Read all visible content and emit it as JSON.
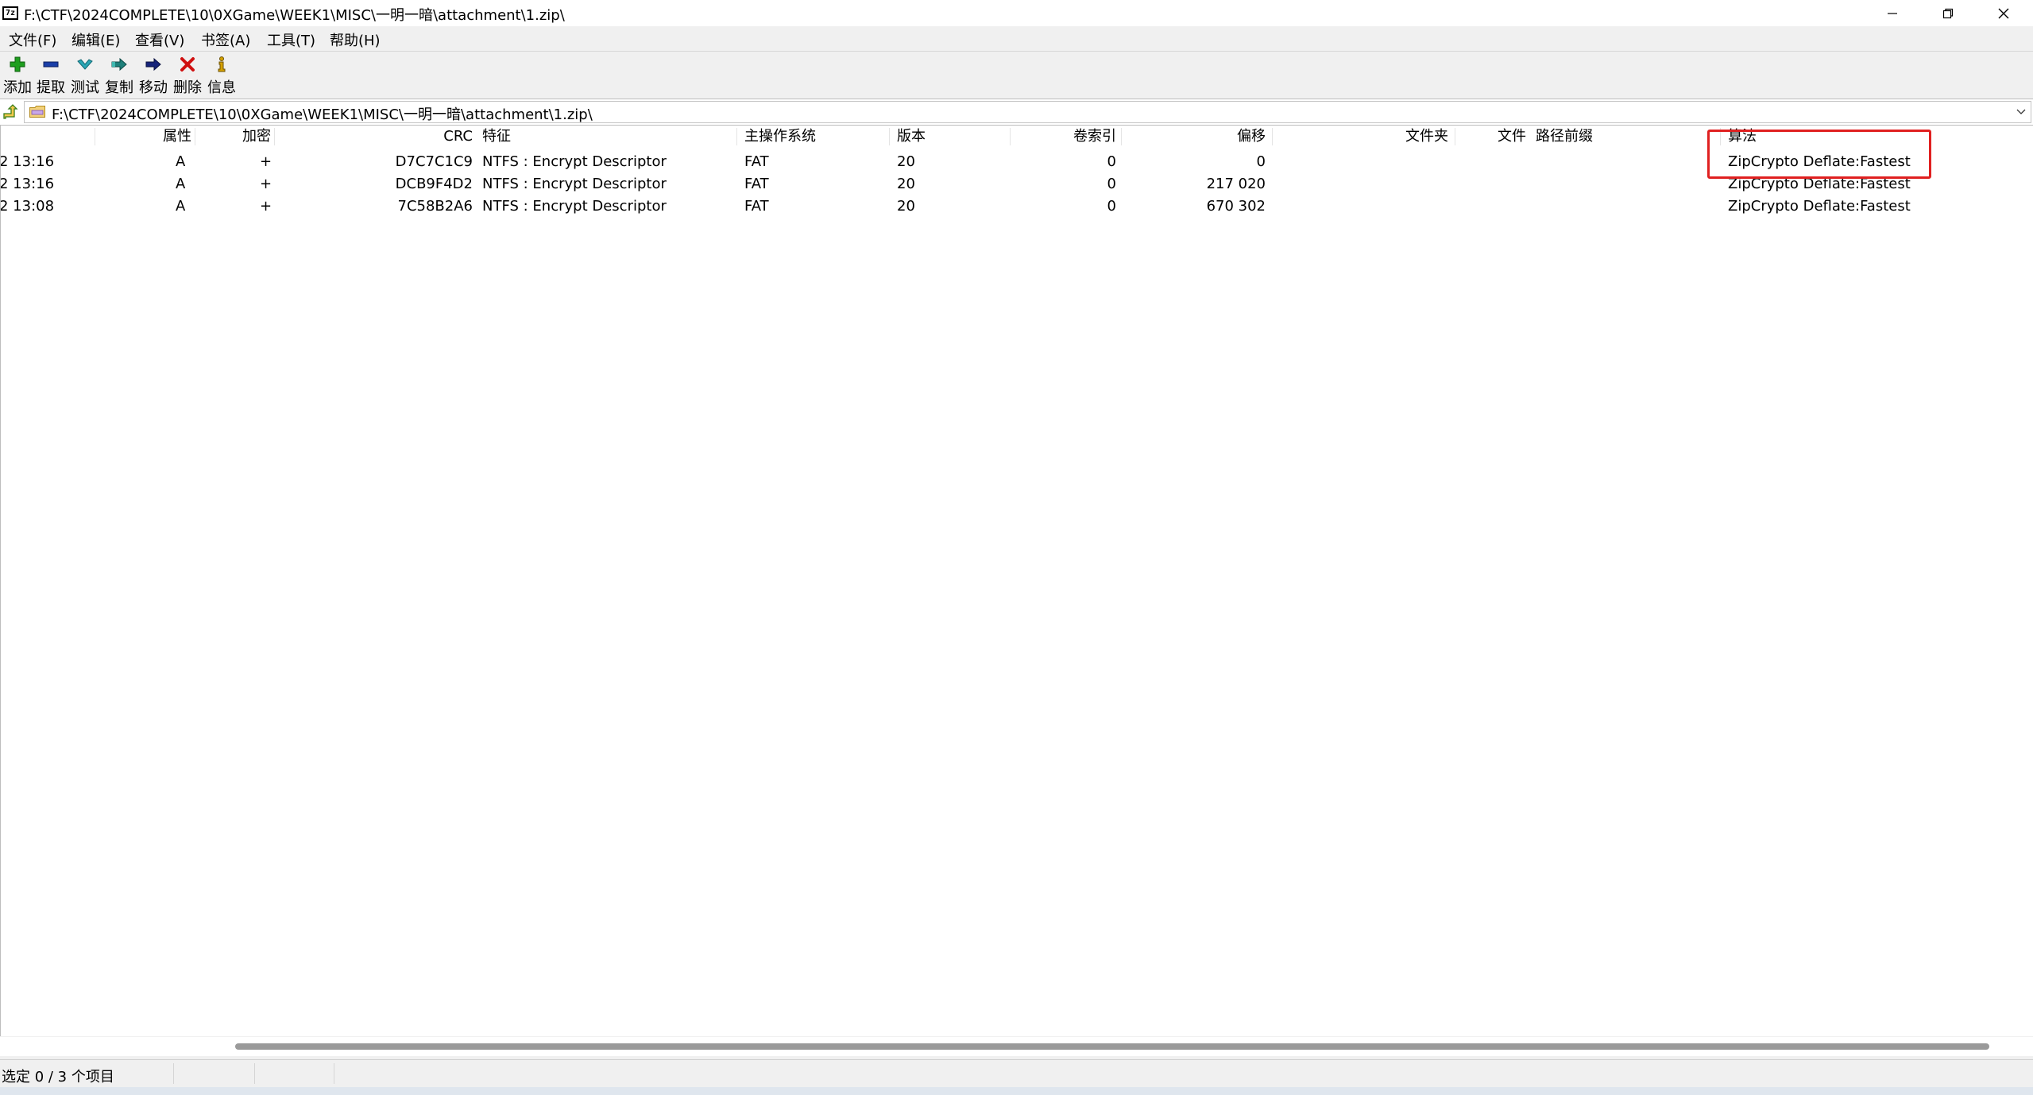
{
  "window": {
    "title": "F:\\CTF\\2024COMPLETE\\10\\0XGame\\WEEK1\\MISC\\一明一暗\\attachment\\1.zip\\",
    "app_icon_text": "7z",
    "minimize_icon": "minimize-icon",
    "maximize_icon": "restore-icon",
    "close_icon": "close-icon"
  },
  "menu": [
    "文件(F)",
    "编辑(E)",
    "查看(V)",
    "书签(A)",
    "工具(T)",
    "帮助(H)"
  ],
  "toolbar": [
    {
      "label": "添加",
      "icon": "plus-icon",
      "color": "#1e9e1e"
    },
    {
      "label": "提取",
      "icon": "minus-icon",
      "color": "#1a3fa8"
    },
    {
      "label": "测试",
      "icon": "check-icon",
      "color": "#2aa6b5"
    },
    {
      "label": "复制",
      "icon": "double-arrow-icon",
      "color": "#1e7f7a"
    },
    {
      "label": "移动",
      "icon": "arrow-right-icon",
      "color": "#16237a"
    },
    {
      "label": "删除",
      "icon": "x-icon",
      "color": "#d01010"
    },
    {
      "label": "信息",
      "icon": "info-icon",
      "color": "#d4a000"
    }
  ],
  "address": {
    "path": "F:\\CTF\\2024COMPLETE\\10\\0XGame\\WEEK1\\MISC\\一明一暗\\attachment\\1.zip\\",
    "up_icon": "folder-up-icon",
    "folder_icon": "archive-folder-icon",
    "dropdown_icon": "chevron-down-icon"
  },
  "columns": {
    "attr": "属性",
    "encrypted": "加密",
    "crc": "CRC",
    "characteristics": "特征",
    "host_os": "主操作系统",
    "version": "版本",
    "volume_index": "卷索引",
    "offset": "偏移",
    "folders": "文件夹",
    "files": "文件",
    "path_prefix": "路径前缀",
    "method": "算法"
  },
  "rows": [
    {
      "modified": "2 13:16",
      "attr": "A",
      "encrypted": "+",
      "crc": "D7C7C1C9",
      "characteristics": "NTFS : Encrypt Descriptor",
      "host_os": "FAT",
      "version": "20",
      "volume_index": "0",
      "offset": "0",
      "method": "ZipCrypto Deflate:Fastest"
    },
    {
      "modified": "2 13:16",
      "attr": "A",
      "encrypted": "+",
      "crc": "DCB9F4D2",
      "characteristics": "NTFS : Encrypt Descriptor",
      "host_os": "FAT",
      "version": "20",
      "volume_index": "0",
      "offset": "217 020",
      "method": "ZipCrypto Deflate:Fastest"
    },
    {
      "modified": "2 13:08",
      "attr": "A",
      "encrypted": "+",
      "crc": "7C58B2A6",
      "characteristics": "NTFS : Encrypt Descriptor",
      "host_os": "FAT",
      "version": "20",
      "volume_index": "0",
      "offset": "670 302",
      "method": "ZipCrypto Deflate:Fastest"
    }
  ],
  "highlight_color": "#e02020",
  "status": {
    "selection": "选定 0 / 3 个项目"
  }
}
